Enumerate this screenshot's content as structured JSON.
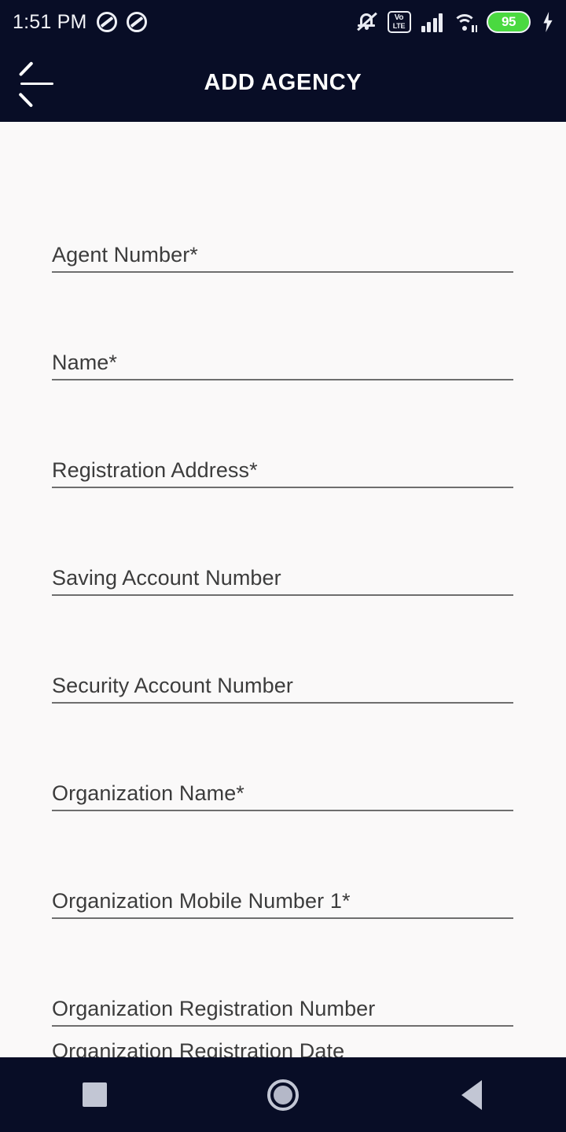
{
  "status_bar": {
    "time": "1:51 PM",
    "battery_level": "95",
    "icons": [
      "dnd-icon",
      "dnd-icon",
      "bell-mute-icon",
      "volte-icon",
      "signal-icon",
      "wifi-icon",
      "battery-icon",
      "charging-bolt-icon"
    ],
    "volte_top": "Vo",
    "volte_bottom": "LTE",
    "colors": {
      "background": "#080d26",
      "foreground": "#ffffff",
      "battery_fill": "#4ad940"
    }
  },
  "app_bar": {
    "title": "ADD AGENCY",
    "back_icon": "arrow-left-icon",
    "background": "#080d26"
  },
  "form": {
    "fields": [
      {
        "label": "Agent Number*",
        "required": true,
        "value": ""
      },
      {
        "label": "Name*",
        "required": true,
        "value": ""
      },
      {
        "label": "Registration Address*",
        "required": true,
        "value": ""
      },
      {
        "label": "Saving Account Number",
        "required": false,
        "value": ""
      },
      {
        "label": "Security Account Number",
        "required": false,
        "value": ""
      },
      {
        "label": "Organization Name*",
        "required": true,
        "value": ""
      },
      {
        "label": "Organization Mobile Number 1*",
        "required": true,
        "value": ""
      },
      {
        "label": "Organization Registration Number",
        "required": false,
        "value": ""
      },
      {
        "label": "Organization Registration Date",
        "required": false,
        "value": ""
      }
    ],
    "background": "#faf9f9",
    "label_color": "#3c3c3c",
    "underline_color": "#6e6e6e"
  },
  "nav_bar": {
    "buttons": [
      {
        "name": "recents-button",
        "icon": "square-icon"
      },
      {
        "name": "home-button",
        "icon": "circle-icon"
      },
      {
        "name": "back-button",
        "icon": "triangle-left-icon"
      }
    ],
    "background": "#080d26"
  }
}
